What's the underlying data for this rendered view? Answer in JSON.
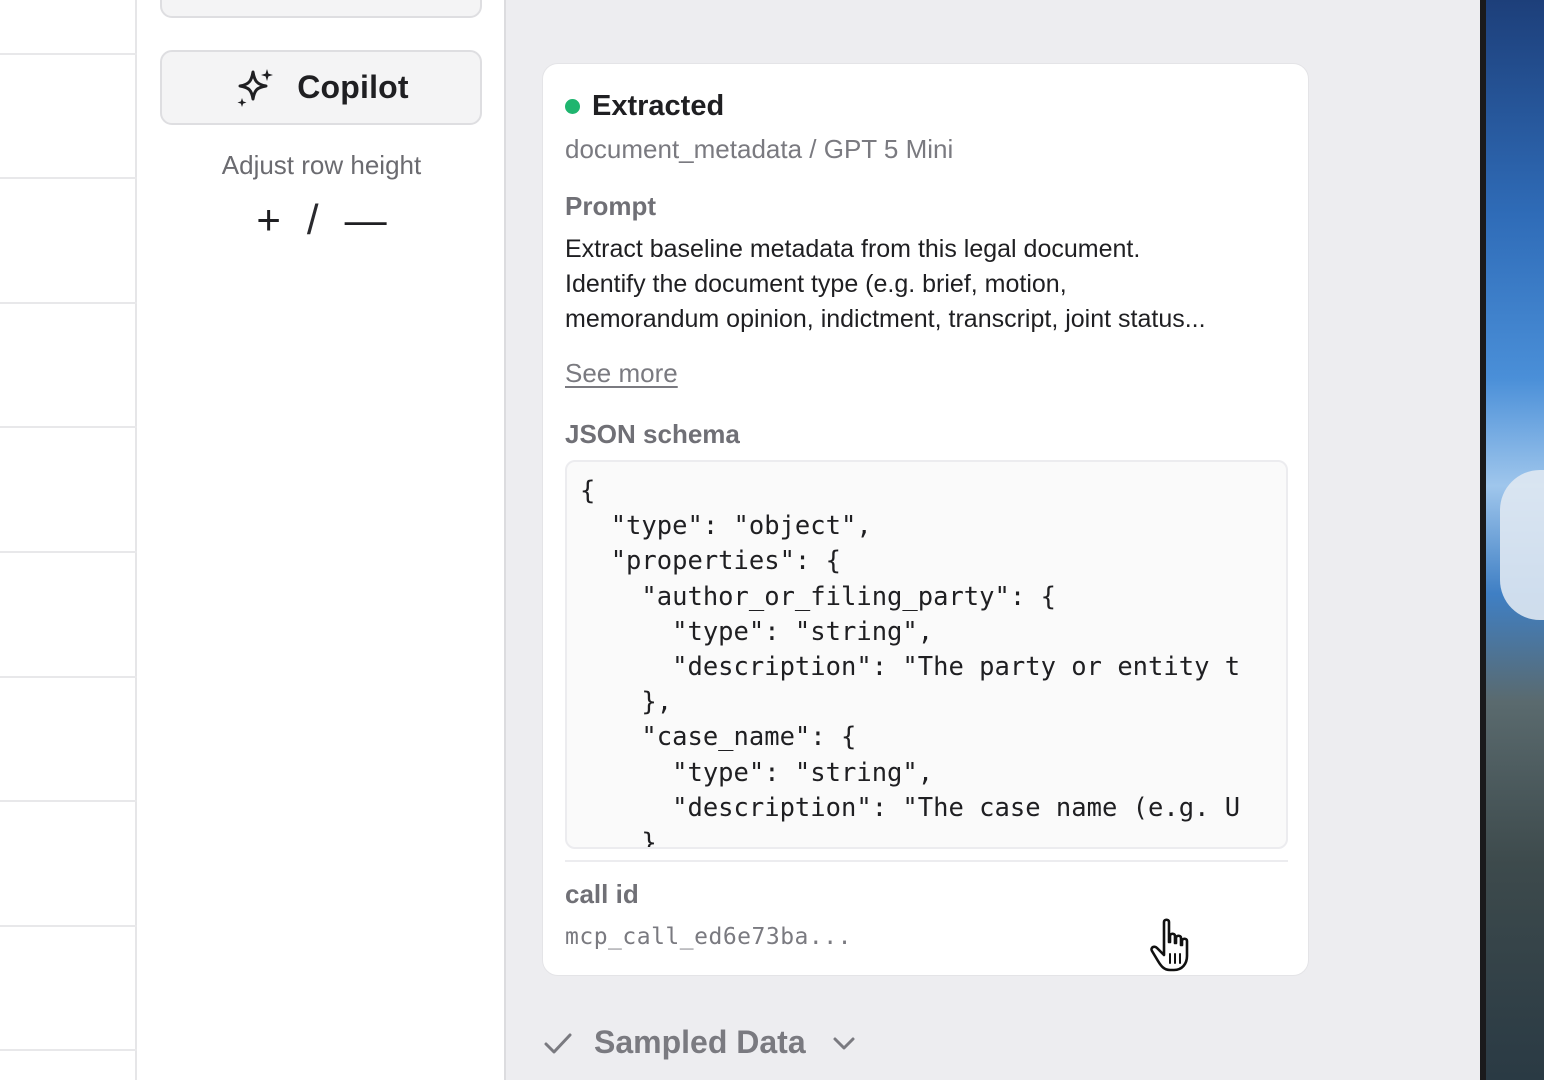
{
  "tools": {
    "copilot_label": "Copilot",
    "adjust_label": "Adjust row height",
    "increase_symbol": "+",
    "separator": "/",
    "decrease_symbol": "—"
  },
  "card": {
    "status": "Extracted",
    "status_color": "#1fb56f",
    "subtitle": "document_metadata / GPT 5 Mini",
    "prompt_label": "Prompt",
    "prompt_lines": [
      "Extract baseline metadata from this legal document.",
      "Identify the document type (e.g. brief, motion,",
      "memorandum opinion, indictment, transcript, joint status..."
    ],
    "see_more": "See more",
    "schema_label": "JSON schema",
    "schema_code": "{\n  \"type\": \"object\",\n  \"properties\": {\n    \"author_or_filing_party\": {\n      \"type\": \"string\",\n      \"description\": \"The party or entity t\n    },\n    \"case_name\": {\n      \"type\": \"string\",\n      \"description\": \"The case name (e.g. U\n    }",
    "call_id_label": "call id",
    "call_id_value": "mcp_call_ed6e73ba..."
  },
  "sampled": {
    "label": "Sampled Data"
  },
  "icons": {
    "copilot": "sparkle-icon",
    "check": "check-icon",
    "chevron": "chevron-down-icon",
    "cursor": "hand-cursor-icon"
  }
}
